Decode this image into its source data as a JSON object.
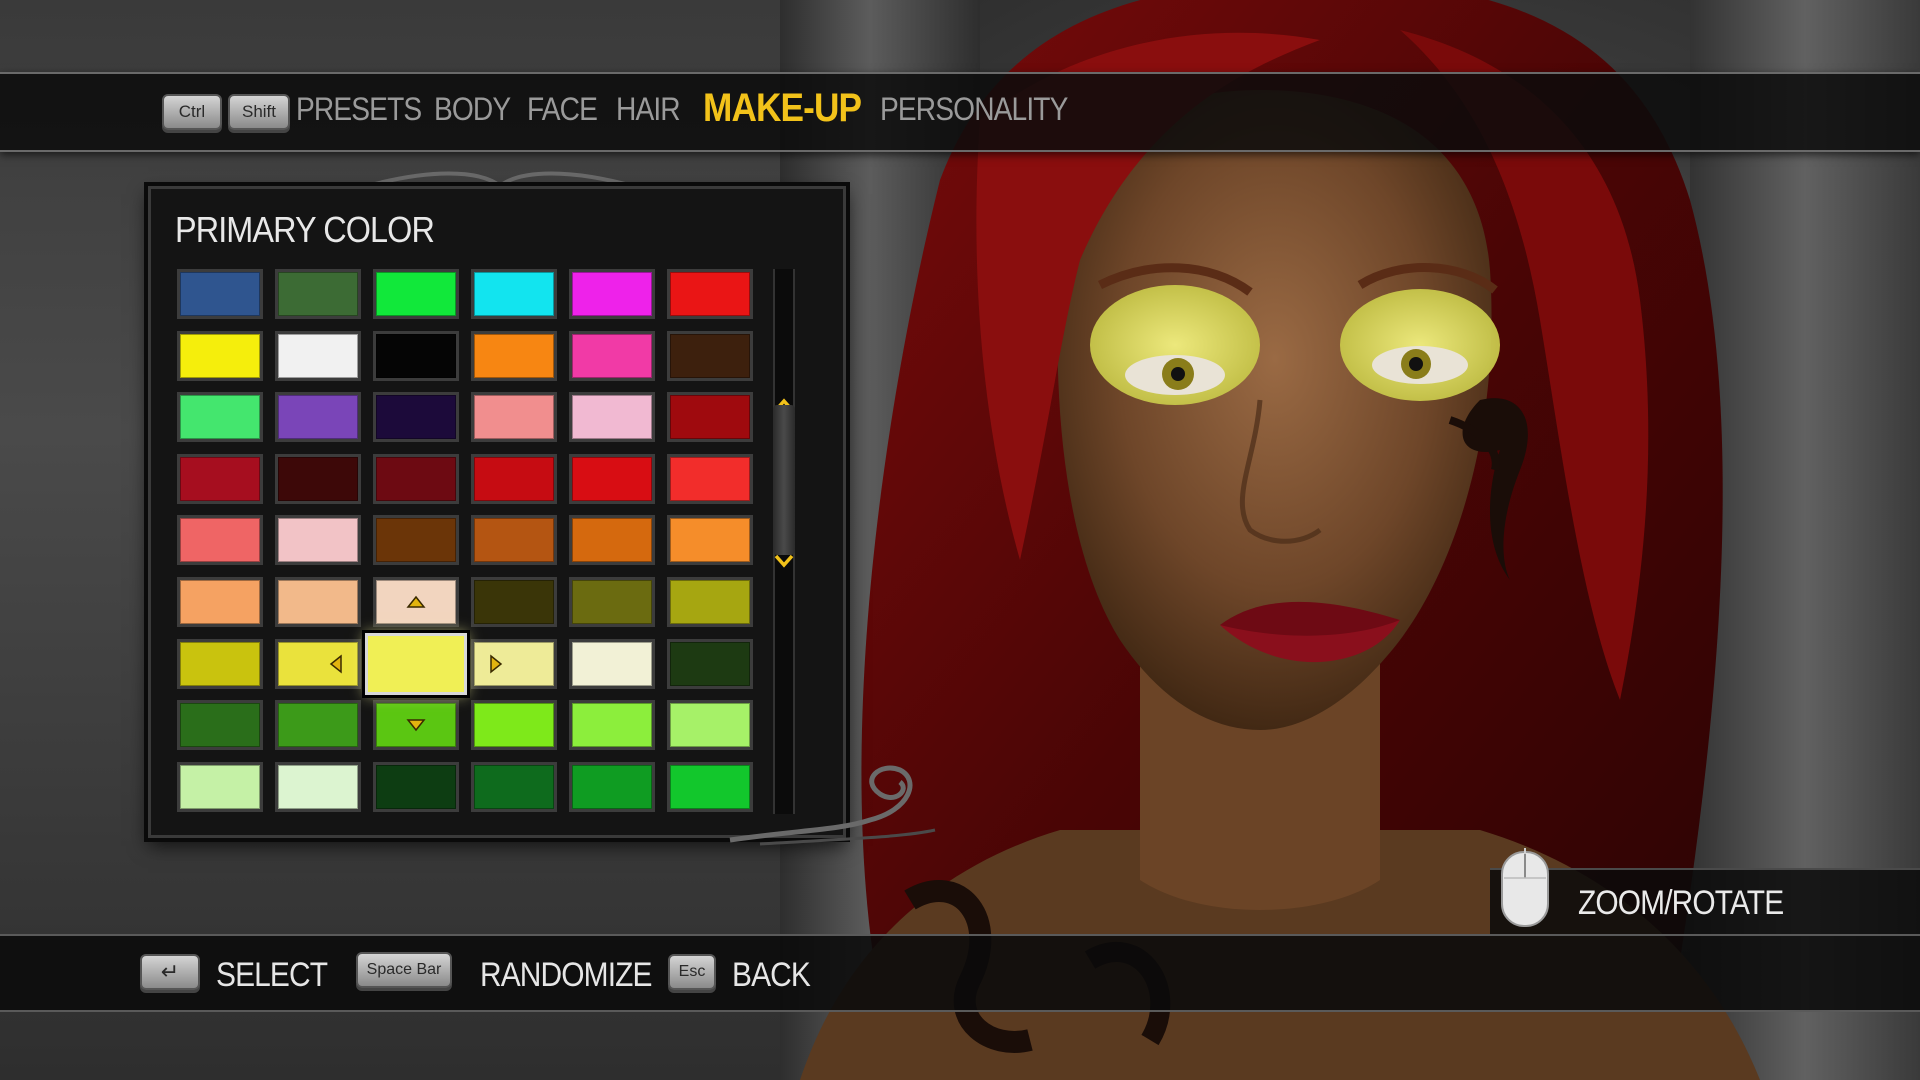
{
  "nav": {
    "prev_key": "Ctrl",
    "next_key": "Shift",
    "tabs": [
      {
        "label": "PRESETS"
      },
      {
        "label": "BODY"
      },
      {
        "label": "FACE"
      },
      {
        "label": "HAIR"
      },
      {
        "label": "MAKE-UP"
      },
      {
        "label": "PERSONALITY"
      }
    ],
    "active_tab": "MAKE-UP"
  },
  "panel": {
    "title": "PRIMARY COLOR",
    "selected_row": 7,
    "selected_col": 3,
    "swatches": [
      [
        "#2f558f",
        "#3c6b34",
        "#11e83a",
        "#12e4ef",
        "#ee22ea",
        "#ea1515"
      ],
      [
        "#f5ee0c",
        "#f1f1f1",
        "#050505",
        "#f78612",
        "#f13aa6",
        "#3d200d"
      ],
      [
        "#44e66e",
        "#7a45b8",
        "#1c0a3a",
        "#f18e8e",
        "#f1b9d2",
        "#9f0a0e"
      ],
      [
        "#a60e1f",
        "#3d0808",
        "#6d0a12",
        "#c60c12",
        "#d80d13",
        "#f22d2b"
      ],
      [
        "#ef6565",
        "#f2c3c6",
        "#6b3508",
        "#b45512",
        "#d5690e",
        "#f58d2a"
      ],
      [
        "#f5a262",
        "#f2b98a",
        "#f2d5bf",
        "#3a3508",
        "#6b6b10",
        "#a6a611"
      ],
      [
        "#c9c30e",
        "#eae23c",
        "#f0ef55",
        "#eeeb98",
        "#f2f1d6",
        "#1d3a12"
      ],
      [
        "#2a6e1a",
        "#3c9a19",
        "#5bc612",
        "#7ee91a",
        "#8cee3c",
        "#a6f168"
      ],
      [
        "#c5f1a6",
        "#dcf4d0",
        "#0d3d12",
        "#0e6b1d",
        "#0f9c22",
        "#12c72c"
      ]
    ]
  },
  "footer": {
    "select_key": "↵",
    "select_label": "SELECT",
    "randomize_key": "Space Bar",
    "randomize_label": "RANDOMIZE",
    "back_key": "Esc",
    "back_label": "BACK",
    "zoom_label": "ZOOM/ROTATE"
  },
  "colors": {
    "accent": "#f2c21a",
    "inactive_tab": "#9a9a9a"
  }
}
